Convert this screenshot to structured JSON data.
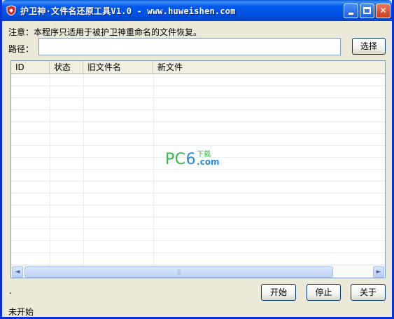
{
  "window": {
    "title": "护卫神·文件名还原工具V1.0 - www.huweishen.com",
    "controls": {
      "min": "minimize",
      "max": "maximize",
      "close": "✕"
    }
  },
  "note": "注意：本程序只适用于被护卫神重命名的文件恢复。",
  "path": {
    "label": "路径：",
    "value": "",
    "placeholder": ""
  },
  "buttons": {
    "choose": "选择",
    "start": "开始",
    "stop": "停止",
    "about": "关于"
  },
  "table": {
    "columns": [
      "ID",
      "状态",
      "旧文件名",
      "新文件"
    ],
    "rows": []
  },
  "watermark": {
    "pc": "PC",
    "six": "6",
    "xz": "下载",
    "com": ".com"
  },
  "scrollbar": {
    "left_arrow": "◄",
    "right_arrow": "►",
    "grip": "|||"
  },
  "dot": ".",
  "status": "未开始",
  "colors": {
    "titlebar": "#0054e3",
    "window_bg": "#ece9d8",
    "watermark_green": "#39b54a",
    "watermark_blue": "#2a8bd6"
  },
  "icons": {
    "app": "shield-icon",
    "minimize": "minimize-icon",
    "maximize": "maximize-icon",
    "close": "close-icon"
  }
}
